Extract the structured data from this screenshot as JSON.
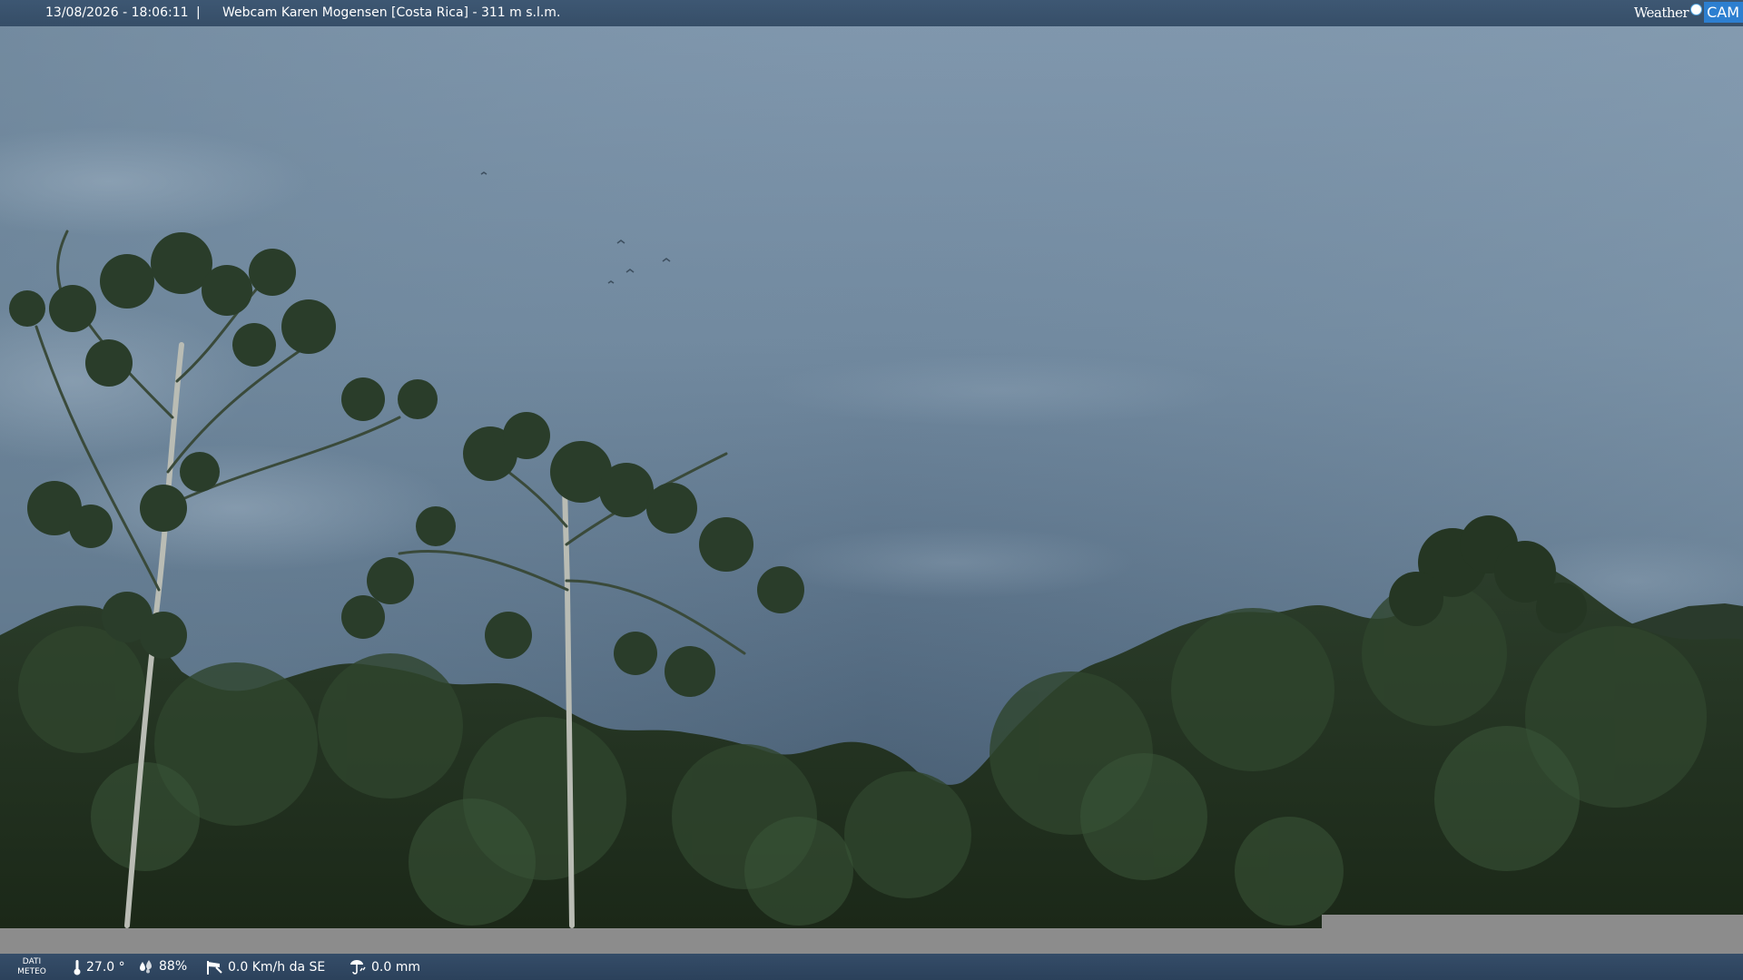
{
  "header": {
    "timestamp": "13/08/2026 - 18:06:11",
    "separator": "|",
    "camera_title": "Webcam Karen Mogensen [Costa Rica] - 311 m s.l.m.",
    "logo_left": "Weather",
    "logo_right": "CAM"
  },
  "footer": {
    "label_line1": "DATI",
    "label_line2": "METEO",
    "temperature": "27.0 °",
    "humidity": "88%",
    "wind": "0.0 Km/h da SE",
    "rain": "0.0 mm"
  },
  "colors": {
    "bar_bg": "#3a5470",
    "logo_accent": "#2d7fd0",
    "sky_top": "#7f97ad",
    "sky_bottom": "#42576b",
    "foliage": "#22331f",
    "strip": "#8c8c8c"
  },
  "icons": {
    "temperature": "thermometer-icon",
    "humidity": "humidity-drops-icon",
    "wind": "wind-sock-icon",
    "rain": "rain-gauge-icon"
  }
}
